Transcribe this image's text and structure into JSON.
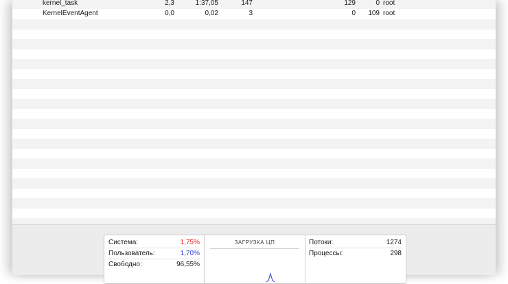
{
  "processes": [
    {
      "name": "kernel_task",
      "cpu": "2,3",
      "cpu_time": "1:37,05",
      "threads": "147",
      "idle_wakeups": "129",
      "pid": "0",
      "user": "root"
    },
    {
      "name": "KernelEventAgent",
      "cpu": "0,0",
      "cpu_time": "0,02",
      "threads": "3",
      "idle_wakeups": "0",
      "pid": "109",
      "user": "root"
    }
  ],
  "stats": {
    "system_label": "Система:",
    "system_value": "1,75%",
    "user_label": "Пользователь:",
    "user_value": "1,70%",
    "idle_label": "Свободно:",
    "idle_value": "96,55%",
    "cpu_load_title": "ЗАГРУЗКА ЦП",
    "threads_label": "Потоки:",
    "threads_value": "1274",
    "processes_label": "Процессы:",
    "processes_value": "298"
  },
  "colors": {
    "system": "#e0221e",
    "user": "#2a3fcf"
  }
}
